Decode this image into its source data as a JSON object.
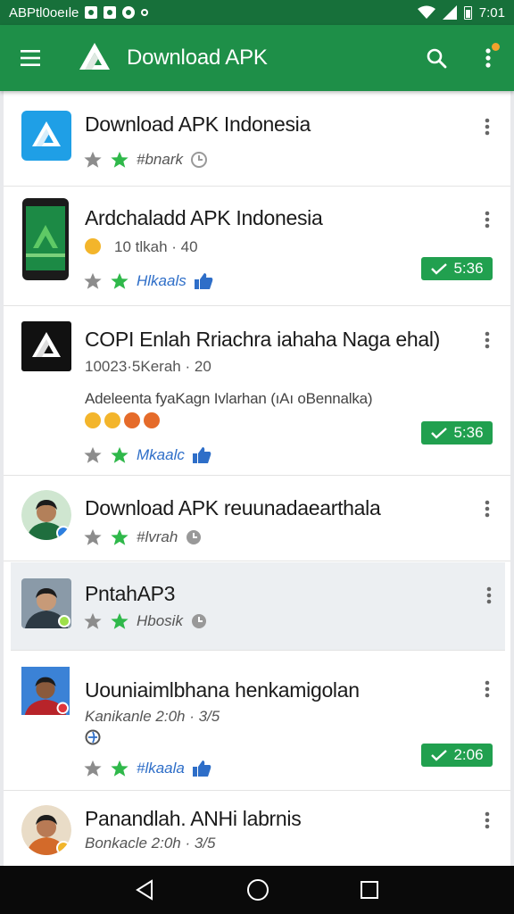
{
  "status_bar": {
    "left_text": "ABPtl0oeıle",
    "time": "7:01"
  },
  "app_bar": {
    "title": "Download APK"
  },
  "items": [
    {
      "title": "Download APK Indonesia",
      "rating_tag": "#bnark"
    },
    {
      "title": "Ardchaladd APK Indonesia",
      "subtitle": "10 tlkah · 40",
      "rating_tag": "Hlkaals",
      "badge": "5:36"
    },
    {
      "title": "COPI Enlah Rriachra iahaha Naga ehal)",
      "subtitle": "10023·5Kerah · 20",
      "desc": "Adeleenta fyaKagn Ivlarhan (ıAı oBennalka)",
      "rating_tag": "Mkaalc",
      "badge": "5:36"
    },
    {
      "title": "Download APK reuunadaearthala",
      "rating_tag": "#lvrah"
    },
    {
      "title": "PntahAP3",
      "rating_tag": "Hbosik"
    },
    {
      "title": "Uouniaimlbhana henkamigolan",
      "subtitle": "Kanikanle 2:0h · 3/5",
      "rating_tag": "#lkaala",
      "badge": "2:06"
    },
    {
      "title": "Panandlah. ANHi labrnis",
      "subtitle": "Bonkacle 2:0h · 3/5"
    }
  ],
  "colors": {
    "primary": "#1e8f48",
    "status": "#17703a",
    "badge": "#21a04f",
    "star_active": "#2fb84a",
    "star_inactive": "#8c8c8c"
  }
}
